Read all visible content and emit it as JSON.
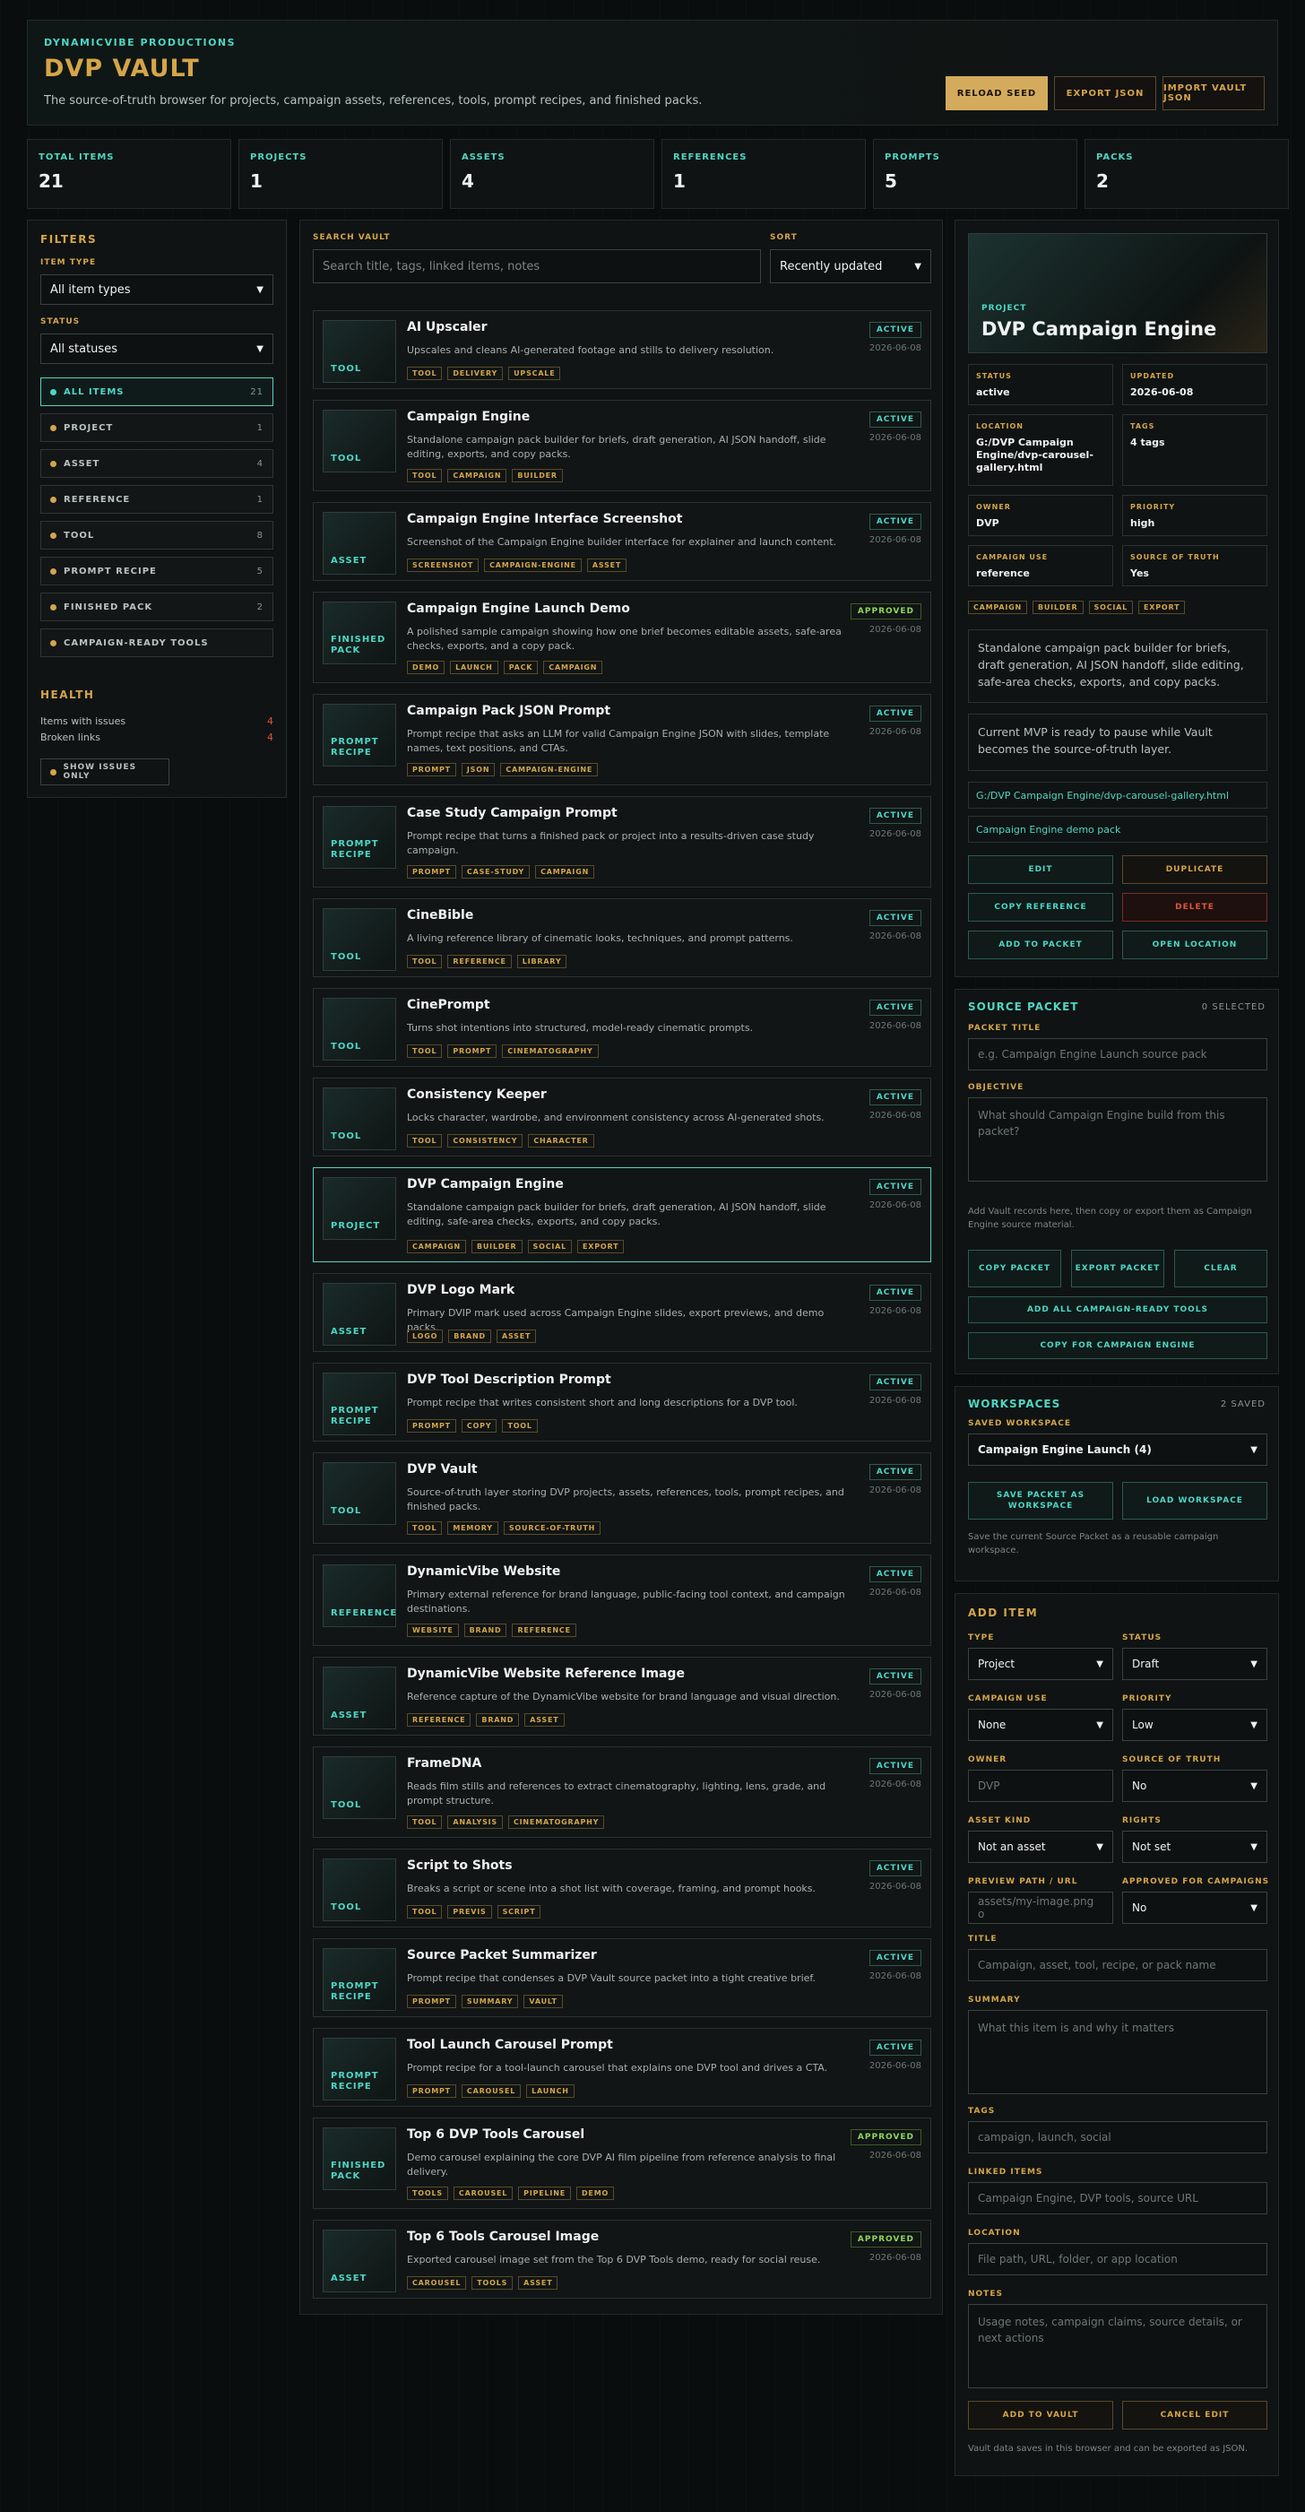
{
  "header": {
    "brand": "DYNAMICVIBE PRODUCTIONS",
    "title": "DVP VAULT",
    "subtitle": "The source-of-truth browser for projects, campaign assets, references, tools, prompt recipes, and finished packs.",
    "reload": "RELOAD SEED",
    "export": "EXPORT JSON",
    "import": "IMPORT VAULT JSON"
  },
  "stats": [
    {
      "label": "TOTAL ITEMS",
      "value": "21"
    },
    {
      "label": "PROJECTS",
      "value": "1"
    },
    {
      "label": "ASSETS",
      "value": "4"
    },
    {
      "label": "REFERENCES",
      "value": "1"
    },
    {
      "label": "PROMPTS",
      "value": "5"
    },
    {
      "label": "PACKS",
      "value": "2"
    }
  ],
  "filters": {
    "title": "FILTERS",
    "type_label": "ITEM TYPE",
    "type_value": "All item types",
    "status_label": "STATUS",
    "status_value": "All statuses",
    "items": [
      {
        "label": "ALL ITEMS",
        "count": "21"
      },
      {
        "label": "PROJECT",
        "count": "1"
      },
      {
        "label": "ASSET",
        "count": "4"
      },
      {
        "label": "REFERENCE",
        "count": "1"
      },
      {
        "label": "TOOL",
        "count": "8"
      },
      {
        "label": "PROMPT RECIPE",
        "count": "5"
      },
      {
        "label": "FINISHED PACK",
        "count": "2"
      },
      {
        "label": "CAMPAIGN-READY TOOLS",
        "count": ""
      }
    ],
    "health_title": "HEALTH",
    "issues_label": "Items with issues",
    "issues_count": "4",
    "broken_label": "Broken links",
    "broken_count": "4",
    "issues_button": "SHOW ISSUES ONLY"
  },
  "search": {
    "label": "SEARCH VAULT",
    "placeholder": "Search title, tags, linked items, notes",
    "sort_label": "SORT",
    "sort_value": "Recently updated"
  },
  "items": [
    {
      "kind": "TOOL",
      "title": "AI Upscaler",
      "summary": "Upscales and cleans AI-generated footage and stills to delivery resolution.",
      "tags": [
        "TOOL",
        "DELIVERY",
        "UPSCALE"
      ],
      "status": "ACTIVE",
      "date": "2026-06-08"
    },
    {
      "kind": "TOOL",
      "title": "Campaign Engine",
      "summary": "Standalone campaign pack builder for briefs, draft generation, AI JSON handoff, slide editing, exports, and copy packs.",
      "tags": [
        "TOOL",
        "CAMPAIGN",
        "BUILDER"
      ],
      "status": "ACTIVE",
      "date": "2026-06-08"
    },
    {
      "kind": "ASSET",
      "title": "Campaign Engine Interface Screenshot",
      "summary": "Screenshot of the Campaign Engine builder interface for explainer and launch content.",
      "tags": [
        "SCREENSHOT",
        "CAMPAIGN-ENGINE",
        "ASSET"
      ],
      "status": "ACTIVE",
      "date": "2026-06-08"
    },
    {
      "kind": "FINISHED\nPACK",
      "title": "Campaign Engine Launch Demo",
      "summary": "A polished sample campaign showing how one brief becomes editable assets, safe-area checks, exports, and a copy pack.",
      "tags": [
        "DEMO",
        "LAUNCH",
        "PACK",
        "CAMPAIGN"
      ],
      "status": "APPROVED",
      "date": "2026-06-08"
    },
    {
      "kind": "PROMPT\nRECIPE",
      "title": "Campaign Pack JSON Prompt",
      "summary": "Prompt recipe that asks an LLM for valid Campaign Engine JSON with slides, template names, text positions, and CTAs.",
      "tags": [
        "PROMPT",
        "JSON",
        "CAMPAIGN-ENGINE"
      ],
      "status": "ACTIVE",
      "date": "2026-06-08"
    },
    {
      "kind": "PROMPT\nRECIPE",
      "title": "Case Study Campaign Prompt",
      "summary": "Prompt recipe that turns a finished pack or project into a results-driven case study campaign.",
      "tags": [
        "PROMPT",
        "CASE-STUDY",
        "CAMPAIGN"
      ],
      "status": "ACTIVE",
      "date": "2026-06-08"
    },
    {
      "kind": "TOOL",
      "title": "CineBible",
      "summary": "A living reference library of cinematic looks, techniques, and prompt patterns.",
      "tags": [
        "TOOL",
        "REFERENCE",
        "LIBRARY"
      ],
      "status": "ACTIVE",
      "date": "2026-06-08"
    },
    {
      "kind": "TOOL",
      "title": "CinePrompt",
      "summary": "Turns shot intentions into structured, model-ready cinematic prompts.",
      "tags": [
        "TOOL",
        "PROMPT",
        "CINEMATOGRAPHY"
      ],
      "status": "ACTIVE",
      "date": "2026-06-08"
    },
    {
      "kind": "TOOL",
      "title": "Consistency Keeper",
      "summary": "Locks character, wardrobe, and environment consistency across AI-generated shots.",
      "tags": [
        "TOOL",
        "CONSISTENCY",
        "CHARACTER"
      ],
      "status": "ACTIVE",
      "date": "2026-06-08"
    },
    {
      "kind": "PROJECT",
      "title": "DVP Campaign Engine",
      "summary": "Standalone campaign pack builder for briefs, draft generation, AI JSON handoff, slide editing, safe-area checks, exports, and copy packs.",
      "tags": [
        "CAMPAIGN",
        "BUILDER",
        "SOCIAL",
        "EXPORT"
      ],
      "status": "ACTIVE",
      "date": "2026-06-08",
      "selected": true
    },
    {
      "kind": "ASSET",
      "title": "DVP Logo Mark",
      "summary": "Primary DVIP mark used across Campaign Engine slides, export previews, and demo packs.",
      "tags": [
        "LOGO",
        "BRAND",
        "ASSET"
      ],
      "status": "ACTIVE",
      "date": "2026-06-08"
    },
    {
      "kind": "PROMPT\nRECIPE",
      "title": "DVP Tool Description Prompt",
      "summary": "Prompt recipe that writes consistent short and long descriptions for a DVP tool.",
      "tags": [
        "PROMPT",
        "COPY",
        "TOOL"
      ],
      "status": "ACTIVE",
      "date": "2026-06-08"
    },
    {
      "kind": "TOOL",
      "title": "DVP Vault",
      "summary": "Source-of-truth layer storing DVP projects, assets, references, tools, prompt recipes, and finished packs.",
      "tags": [
        "TOOL",
        "MEMORY",
        "SOURCE-OF-TRUTH"
      ],
      "status": "ACTIVE",
      "date": "2026-06-08"
    },
    {
      "kind": "REFERENCE",
      "title": "DynamicVibe Website",
      "summary": "Primary external reference for brand language, public-facing tool context, and campaign destinations.",
      "tags": [
        "WEBSITE",
        "BRAND",
        "REFERENCE"
      ],
      "status": "ACTIVE",
      "date": "2026-06-08"
    },
    {
      "kind": "ASSET",
      "title": "DynamicVibe Website Reference Image",
      "summary": "Reference capture of the DynamicVibe website for brand language and visual direction.",
      "tags": [
        "REFERENCE",
        "BRAND",
        "ASSET"
      ],
      "status": "ACTIVE",
      "date": "2026-06-08"
    },
    {
      "kind": "TOOL",
      "title": "FrameDNA",
      "summary": "Reads film stills and references to extract cinematography, lighting, lens, grade, and prompt structure.",
      "tags": [
        "TOOL",
        "ANALYSIS",
        "CINEMATOGRAPHY"
      ],
      "status": "ACTIVE",
      "date": "2026-06-08"
    },
    {
      "kind": "TOOL",
      "title": "Script to Shots",
      "summary": "Breaks a script or scene into a shot list with coverage, framing, and prompt hooks.",
      "tags": [
        "TOOL",
        "PREVIS",
        "SCRIPT"
      ],
      "status": "ACTIVE",
      "date": "2026-06-08"
    },
    {
      "kind": "PROMPT\nRECIPE",
      "title": "Source Packet Summarizer",
      "summary": "Prompt recipe that condenses a DVP Vault source packet into a tight creative brief.",
      "tags": [
        "PROMPT",
        "SUMMARY",
        "VAULT"
      ],
      "status": "ACTIVE",
      "date": "2026-06-08"
    },
    {
      "kind": "PROMPT\nRECIPE",
      "title": "Tool Launch Carousel Prompt",
      "summary": "Prompt recipe for a tool-launch carousel that explains one DVP tool and drives a CTA.",
      "tags": [
        "PROMPT",
        "CAROUSEL",
        "LAUNCH"
      ],
      "status": "ACTIVE",
      "date": "2026-06-08"
    },
    {
      "kind": "FINISHED\nPACK",
      "title": "Top 6 DVP Tools Carousel",
      "summary": "Demo carousel explaining the core DVP AI film pipeline from reference analysis to final delivery.",
      "tags": [
        "TOOLS",
        "CAROUSEL",
        "PIPELINE",
        "DEMO"
      ],
      "status": "APPROVED",
      "date": "2026-06-08"
    },
    {
      "kind": "ASSET",
      "title": "Top 6 Tools Carousel Image",
      "summary": "Exported carousel image set from the Top 6 DVP Tools demo, ready for social reuse.",
      "tags": [
        "CAROUSEL",
        "TOOLS",
        "ASSET"
      ],
      "status": "APPROVED",
      "date": "2026-06-08"
    }
  ],
  "detail": {
    "kind": "PROJECT",
    "title": "DVP Campaign Engine",
    "fields": [
      {
        "k": "STATUS",
        "v": "active"
      },
      {
        "k": "UPDATED",
        "v": "2026-06-08"
      },
      {
        "k": "LOCATION",
        "v": "G:/DVP Campaign Engine/dvp-carousel-gallery.html"
      },
      {
        "k": "TAGS",
        "v": "4 tags"
      },
      {
        "k": "OWNER",
        "v": "DVP"
      },
      {
        "k": "PRIORITY",
        "v": "high"
      },
      {
        "k": "CAMPAIGN USE",
        "v": "reference"
      },
      {
        "k": "SOURCE OF TRUTH",
        "v": "Yes"
      }
    ],
    "tags": [
      "CAMPAIGN",
      "BUILDER",
      "SOCIAL",
      "EXPORT"
    ],
    "summary": "Standalone campaign pack builder for briefs, draft generation, AI JSON handoff, slide editing, safe-area checks, exports, and copy packs.",
    "note": "Current MVP is ready to pause while Vault becomes the source-of-truth layer.",
    "link1": "G:/DVP Campaign Engine/dvp-carousel-gallery.html",
    "link2": "Campaign Engine demo pack",
    "buttons": {
      "edit": "EDIT",
      "duplicate": "DUPLICATE",
      "copy": "COPY REFERENCE",
      "delete": "DELETE",
      "packet": "ADD TO PACKET",
      "open": "OPEN LOCATION"
    }
  },
  "packet": {
    "title": "SOURCE PACKET",
    "count": "0 SELECTED",
    "title_label": "PACKET TITLE",
    "title_ph": "e.g. Campaign Engine Launch source pack",
    "obj_label": "OBJECTIVE",
    "obj_ph": "What should Campaign Engine build from this packet?",
    "hint": "Add Vault records here, then copy or export them as Campaign Engine source material.",
    "copy": "COPY PACKET",
    "export": "EXPORT PACKET",
    "clear": "CLEAR",
    "addall": "ADD ALL CAMPAIGN-READY TOOLS",
    "copyfor": "COPY FOR CAMPAIGN ENGINE"
  },
  "workspaces": {
    "title": "WORKSPACES",
    "count": "2 SAVED",
    "label": "SAVED WORKSPACE",
    "value": "Campaign Engine Launch (4)",
    "save": "SAVE PACKET AS WORKSPACE",
    "load": "LOAD WORKSPACE",
    "hint": "Save the current Source Packet as a reusable campaign workspace."
  },
  "add": {
    "title": "ADD ITEM",
    "type_l": "TYPE",
    "type_v": "Project",
    "status_l": "STATUS",
    "status_v": "Draft",
    "use_l": "CAMPAIGN USE",
    "use_v": "None",
    "prio_l": "PRIORITY",
    "prio_v": "Low",
    "owner_l": "OWNER",
    "owner_ph": "DVP",
    "sot_l": "SOURCE OF TRUTH",
    "sot_v": "No",
    "kind_l": "ASSET KIND",
    "kind_v": "Not an asset",
    "rights_l": "RIGHTS",
    "rights_v": "Not set",
    "prev_l": "PREVIEW PATH / URL",
    "prev_ph": "assets/my-image.png o",
    "appr_l": "APPROVED FOR CAMPAIGNS",
    "appr_v": "No",
    "title_l": "TITLE",
    "title_ph": "Campaign, asset, tool, recipe, or pack name",
    "sum_l": "SUMMARY",
    "sum_ph": "What this item is and why it matters",
    "tags_l": "TAGS",
    "tags_ph": "campaign, launch, social",
    "links_l": "LINKED ITEMS",
    "links_ph": "Campaign Engine, DVP tools, source URL",
    "loc_l": "LOCATION",
    "loc_ph": "File path, URL, folder, or app location",
    "notes_l": "NOTES",
    "notes_ph": "Usage notes, campaign claims, source details, or next actions",
    "add_btn": "ADD TO VAULT",
    "cancel_btn": "CANCEL EDIT",
    "footer": "Vault data saves in this browser and can be exported as JSON."
  },
  "colors": {
    "gold": "#d4a54a",
    "teal": "#4ed6c4",
    "danger": "#e0553f"
  }
}
